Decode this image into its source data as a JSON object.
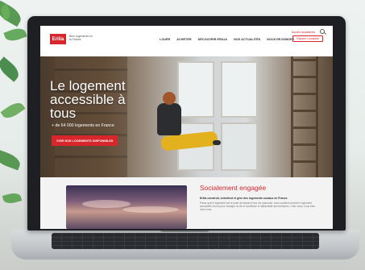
{
  "site": {
    "logo_text": "Erilia",
    "logo_tagline": "Bien logements en la France",
    "top_links": [
      "Accès locataires"
    ],
    "nav_items": [
      "LOUER",
      "ACHETER",
      "DÉCOUVRIR ERILIA",
      "NOS ACTUALITÉS",
      "NOUS REJOINDRE"
    ],
    "cta_small": "Espace Locataire"
  },
  "hero": {
    "title": "Le logement accessible à tous",
    "subtitle": "+ de 64 000 logements en France",
    "button": "VOIR NOS LOGEMENTS DISPONIBLES"
  },
  "section": {
    "title": "Socialement engagée",
    "lead": "Erilia construit, entretient et gère des logements sociaux en France.",
    "text": "Parce que le logement est le point de départ d'une vie épanouie, nous confions rendre le logement accessible à tous pour changer la vie et contribuer à l'attractivité des territoires. Chez nous, vous êtes chez vous."
  },
  "colors": {
    "brand_red": "#d7262c"
  }
}
